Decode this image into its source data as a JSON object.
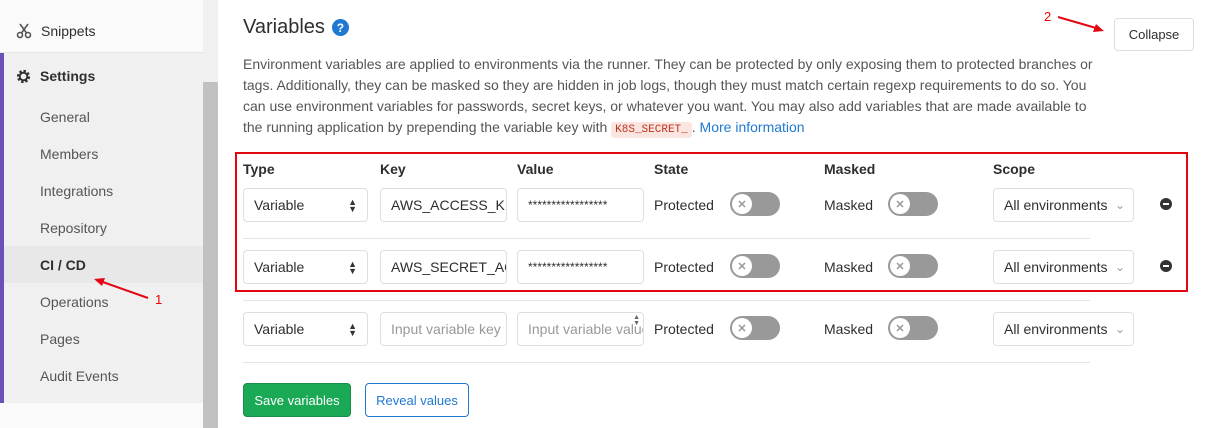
{
  "sidebar": {
    "snippets": "Snippets",
    "settings": "Settings",
    "items": [
      {
        "label": "General"
      },
      {
        "label": "Members"
      },
      {
        "label": "Integrations"
      },
      {
        "label": "Repository"
      },
      {
        "label": "CI / CD",
        "active": true
      },
      {
        "label": "Operations"
      },
      {
        "label": "Pages"
      },
      {
        "label": "Audit Events"
      }
    ]
  },
  "section": {
    "title": "Variables",
    "collapse_label": "Collapse",
    "description_1": "Environment variables are applied to environments via the runner. They can be protected by only exposing them to protected branches or tags. Additionally, they can be masked so they are hidden in job logs, though they must match certain regexp requirements to do so. You can use environment variables for passwords, secret keys, or whatever you want. You may also add variables that are made available to the running application by prepending the variable key with",
    "code_prefix": "K8S_SECRET_",
    "more_info": "More information"
  },
  "table": {
    "headers": {
      "type": "Type",
      "key": "Key",
      "value": "Value",
      "state": "State",
      "masked": "Masked",
      "scope": "Scope"
    },
    "rows": [
      {
        "type": "Variable",
        "key": "AWS_ACCESS_KEY_ID",
        "value": "*****************",
        "state": "Protected",
        "masked": "Masked",
        "scope": "All environments"
      },
      {
        "type": "Variable",
        "key": "AWS_SECRET_ACCESS_KEY",
        "value": "*****************",
        "state": "Protected",
        "masked": "Masked",
        "scope": "All environments"
      },
      {
        "type": "Variable",
        "key_placeholder": "Input variable key",
        "value_placeholder": "Input variable value",
        "state": "Protected",
        "masked": "Masked",
        "scope": "All environments"
      }
    ]
  },
  "buttons": {
    "save": "Save variables",
    "reveal": "Reveal values"
  },
  "annotations": {
    "one": "1",
    "two": "2"
  },
  "colors": {
    "accent": "#6b4fbb",
    "save": "#1aaa55",
    "link": "#1f78d1",
    "highlight": "#e30613"
  }
}
